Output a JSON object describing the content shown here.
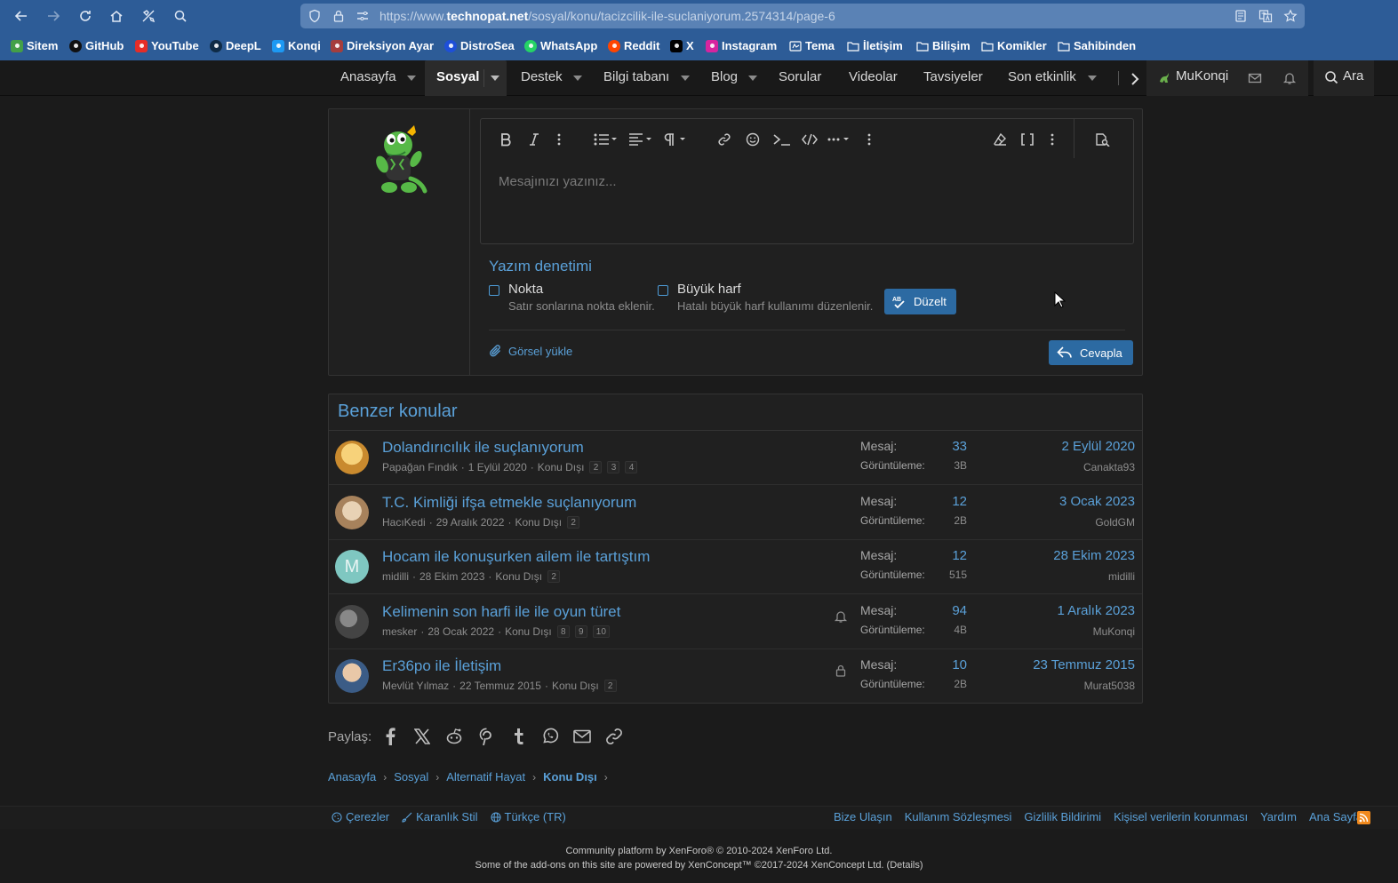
{
  "browser": {
    "url_scheme": "https://www.",
    "url_domain": "technopat.net",
    "url_path": "/sosyal/konu/tacizcilik-ile-suclaniyorum.2574314/page-6",
    "bookmarks": [
      {
        "label": "Sitem",
        "icon": "gecko-icon",
        "color": "#43a047"
      },
      {
        "label": "GitHub",
        "icon": "github-icon",
        "color": "#111111"
      },
      {
        "label": "YouTube",
        "icon": "youtube-icon",
        "color": "#e52d27"
      },
      {
        "label": "DeepL",
        "icon": "deepl-icon",
        "color": "#0f2b46"
      },
      {
        "label": "Konqi",
        "icon": "kde-icon",
        "color": "#1d99f3"
      },
      {
        "label": "Direksiyon Ayar",
        "icon": "image-icon",
        "color": "#a53d3d"
      },
      {
        "label": "DistroSea",
        "icon": "distrosea-icon",
        "color": "#1e4fd8"
      },
      {
        "label": "WhatsApp",
        "icon": "whatsapp-icon",
        "color": "#25d366"
      },
      {
        "label": "Reddit",
        "icon": "reddit-icon",
        "color": "#ff4500"
      },
      {
        "label": "X",
        "icon": "x-icon",
        "color": "#000000"
      },
      {
        "label": "Instagram",
        "icon": "instagram-icon",
        "color": "#d6249f"
      },
      {
        "label": "Tema",
        "icon": "theme-icon",
        "color": "#2d5c97"
      },
      {
        "label": "İletişim",
        "icon": "folder-icon",
        "color": "#2d5c97"
      },
      {
        "label": "Bilişim",
        "icon": "folder-icon",
        "color": "#2d5c97"
      },
      {
        "label": "Komikler",
        "icon": "folder-icon",
        "color": "#2d5c97"
      },
      {
        "label": "Sahibinden",
        "icon": "folder-icon",
        "color": "#2d5c97"
      }
    ]
  },
  "nav": {
    "tabs": [
      {
        "label": "Anasayfa"
      },
      {
        "label": "Sosyal"
      },
      {
        "label": "Destek"
      },
      {
        "label": "Bilgi tabanı"
      },
      {
        "label": "Blog"
      },
      {
        "label": "Sorular"
      },
      {
        "label": "Videolar"
      },
      {
        "label": "Tavsiyeler"
      },
      {
        "label": "Son etkinlik"
      }
    ],
    "user": "MuKonqi",
    "search": "Ara"
  },
  "editor": {
    "placeholder": "Mesajınızı yazınız...",
    "spell_title": "Yazım denetimi",
    "opt1_label": "Nokta",
    "opt1_hint": "Satır sonlarına nokta eklenir.",
    "opt2_label": "Büyük harf",
    "opt2_hint": "Hatalı büyük harf kullanımı düzenlenir.",
    "fix_button": "Düzelt",
    "upload": "Görsel yükle",
    "reply_button": "Cevapla"
  },
  "similar": {
    "title": "Benzer konular",
    "label_messages": "Mesaj:",
    "label_views": "Görüntüleme:",
    "threads": [
      {
        "title": "Dolandırıcılık ile suçlanıyorum",
        "author": "Papağan Fındık",
        "date": "1 Eylül 2020",
        "forum": "Konu Dışı",
        "pages": [
          "2",
          "3",
          "4"
        ],
        "messages": "33",
        "views": "3B",
        "last_date": "2 Eylül 2020",
        "last_user": "Canakta93",
        "state": ""
      },
      {
        "title": "T.C. Kimliği ifşa etmekle suçlanıyorum",
        "author": "HacıKedi",
        "date": "29 Aralık 2022",
        "forum": "Konu Dışı",
        "pages": [
          "2"
        ],
        "messages": "12",
        "views": "2B",
        "last_date": "3 Ocak 2023",
        "last_user": "GoldGM",
        "state": ""
      },
      {
        "title": "Hocam ile konuşurken ailem ile tartıştım",
        "author": "midilli",
        "date": "28 Ekim 2023",
        "forum": "Konu Dışı",
        "pages": [
          "2"
        ],
        "messages": "12",
        "views": "515",
        "last_date": "28 Ekim 2023",
        "last_user": "midilli",
        "state": "",
        "avatar_letter": "M"
      },
      {
        "title": "Kelimenin son harfi ile ile oyun türet",
        "author": "mesker",
        "date": "28 Ocak 2022",
        "forum": "Konu Dışı",
        "pages": [
          "8",
          "9",
          "10"
        ],
        "messages": "94",
        "views": "4B",
        "last_date": "1 Aralık 2023",
        "last_user": "MuKonqi",
        "state": "bell"
      },
      {
        "title": "Er36po ile İletişim",
        "author": "Mevlüt Yılmaz",
        "date": "22 Temmuz 2015",
        "forum": "Konu Dışı",
        "pages": [
          "2"
        ],
        "messages": "10",
        "views": "2B",
        "last_date": "23 Temmuz 2015",
        "last_user": "Murat5038",
        "state": "lock"
      }
    ]
  },
  "share": {
    "label": "Paylaş:"
  },
  "breadcrumb": [
    "Anasayfa",
    "Sosyal",
    "Alternatif Hayat",
    "Konu Dışı"
  ],
  "footer": {
    "left": [
      "Çerezler",
      "Karanlık Stil",
      "Türkçe (TR)"
    ],
    "right": [
      "Bize Ulaşın",
      "Kullanım Sözleşmesi",
      "Gizlilik Bildirimi",
      "Kişisel verilerin korunması",
      "Yardım",
      "Ana Sayfa"
    ],
    "copyright1": "Community platform by XenForo® © 2010-2024 XenForo Ltd.",
    "copyright2": "Some of the add-ons on this site are powered by XenConcept™ ©2017-2024 XenConcept Ltd. (Details)"
  }
}
